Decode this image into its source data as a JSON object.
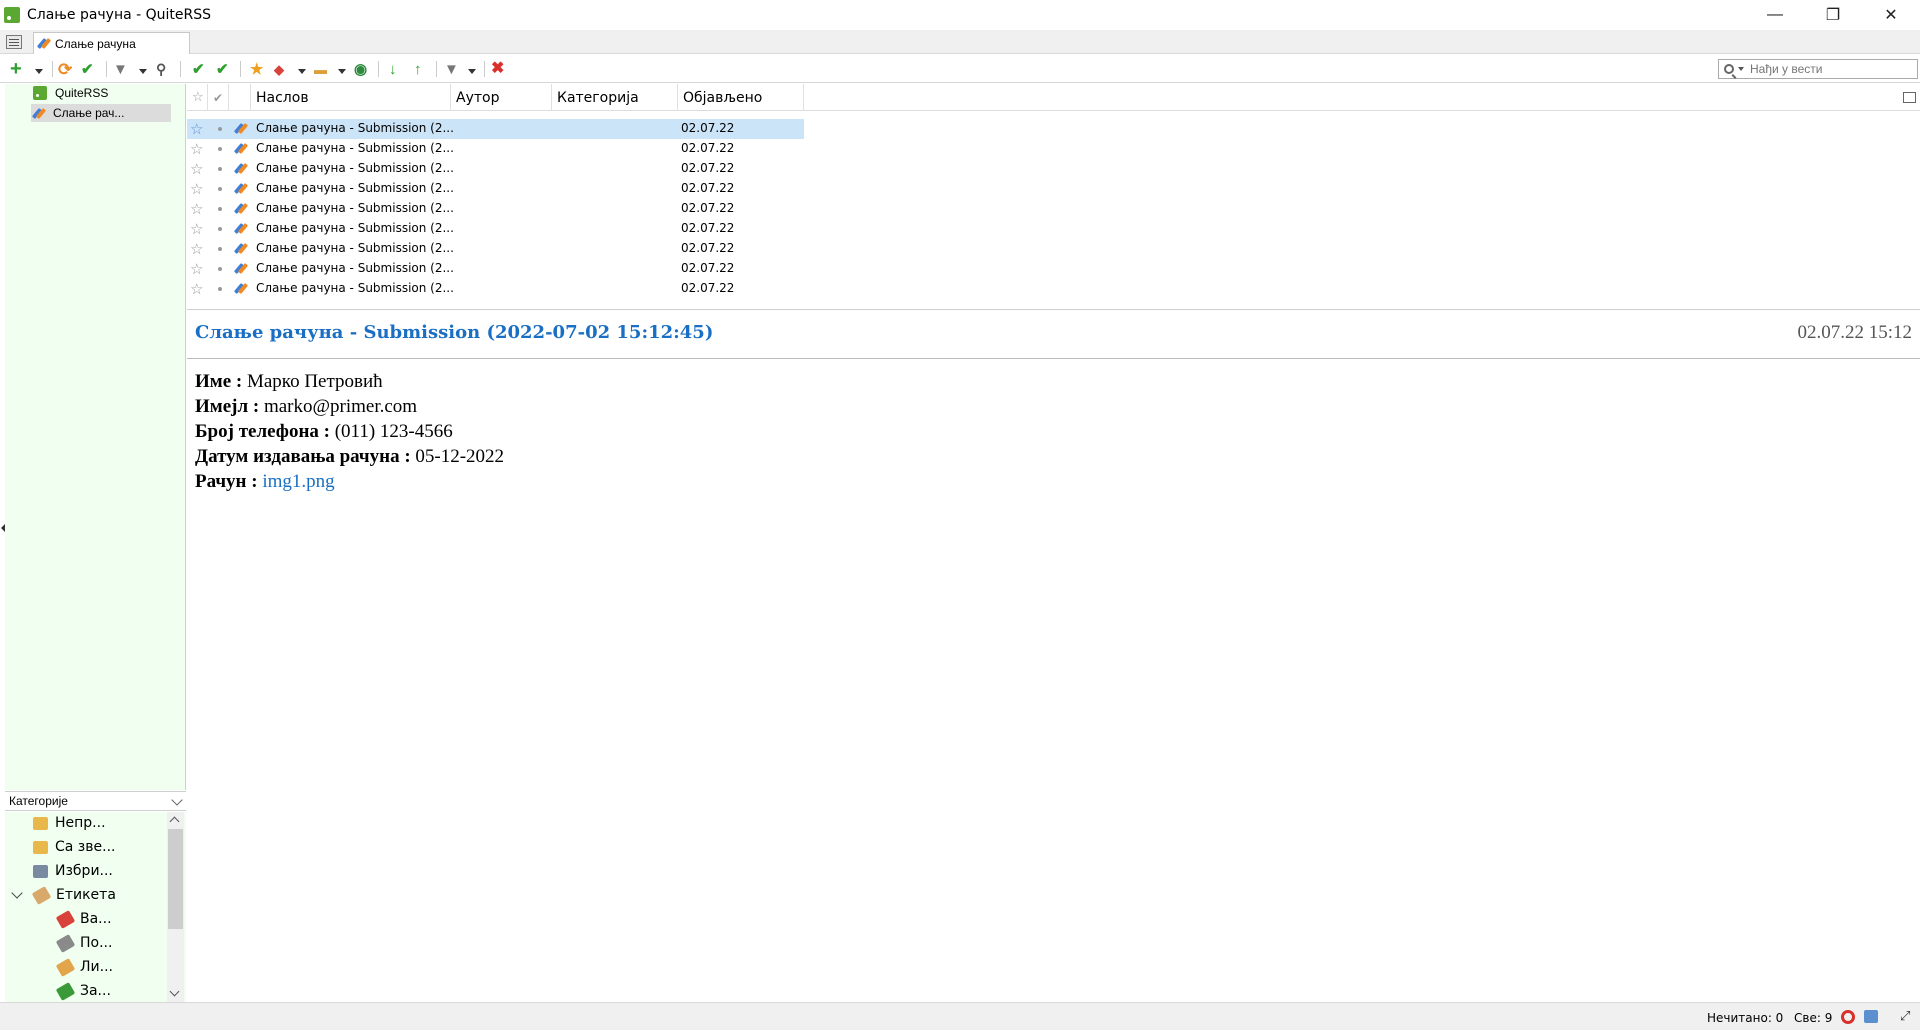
{
  "window": {
    "title": "Слање рачуна - QuiteRSS",
    "minimize": "—",
    "maximize": "❐",
    "close": "✕"
  },
  "tab": {
    "label": "Слање рачуна"
  },
  "search": {
    "placeholder": "Нађи у вести"
  },
  "feeds_tree": {
    "items": [
      {
        "label": "QuiteRSS",
        "icon": "rss-icon",
        "selected": false
      },
      {
        "label": "Слање рач...",
        "icon": "feed-icon",
        "selected": true
      }
    ]
  },
  "categories": {
    "header": "Категорије",
    "items": [
      {
        "label": "Непр...",
        "icon": "unread-folder-icon",
        "color": "#e8b94a"
      },
      {
        "label": "Са зве...",
        "icon": "starred-folder-icon",
        "color": "#e8b94a"
      },
      {
        "label": "Избри...",
        "icon": "deleted-icon",
        "color": "#7a8aa0"
      },
      {
        "label": "Етикета",
        "icon": "label-icon",
        "color": "#d9a86b",
        "expandable": true
      },
      {
        "label": "Ва...",
        "icon": "tag-red-icon",
        "color": "#d9413b"
      },
      {
        "label": "По...",
        "icon": "tag-gray-icon",
        "color": "#8a8a8a"
      },
      {
        "label": "Ли...",
        "icon": "tag-orange-icon",
        "color": "#e3a54b"
      },
      {
        "label": "За...",
        "icon": "tag-green-icon",
        "color": "#3a9a3a"
      }
    ]
  },
  "news_list": {
    "columns": [
      "Наслов",
      "Аутор",
      "Категорија",
      "Објављено"
    ],
    "rows": [
      {
        "title": "Слање рачуна - Submission (2...",
        "date": "02.07.22",
        "selected": true
      },
      {
        "title": "Слање рачуна - Submission (2...",
        "date": "02.07.22",
        "selected": false
      },
      {
        "title": "Слање рачуна - Submission (2...",
        "date": "02.07.22",
        "selected": false
      },
      {
        "title": "Слање рачуна - Submission (2...",
        "date": "02.07.22",
        "selected": false
      },
      {
        "title": "Слање рачуна - Submission (2...",
        "date": "02.07.22",
        "selected": false
      },
      {
        "title": "Слање рачуна - Submission (2...",
        "date": "02.07.22",
        "selected": false
      },
      {
        "title": "Слање рачуна - Submission (2...",
        "date": "02.07.22",
        "selected": false
      },
      {
        "title": "Слање рачуна - Submission (2...",
        "date": "02.07.22",
        "selected": false
      },
      {
        "title": "Слање рачуна - Submission (2...",
        "date": "02.07.22",
        "selected": false
      }
    ]
  },
  "article": {
    "title": "Слање рачуна - Submission (2022-07-02 15:12:45)",
    "date": "02.07.22 15:12",
    "fields": [
      {
        "label": "Име :",
        "value": "Марко Петровић",
        "is_link": false
      },
      {
        "label": "Имејл :",
        "value": "marko@primer.com",
        "is_link": false
      },
      {
        "label": "Број телефона :",
        "value": "(011) 123-4566",
        "is_link": false
      },
      {
        "label": "Датум издавања рачуна :",
        "value": "05-12-2022",
        "is_link": false
      },
      {
        "label": "Рачун :",
        "value": "img1.png",
        "is_link": true
      }
    ]
  },
  "status": {
    "unread": "Нечитано: 0",
    "all": "Све: 9"
  },
  "colors": {
    "accent": "#1a6fc4",
    "tree_bg": "#f0fff0",
    "selected_row": "#cce4f7"
  }
}
